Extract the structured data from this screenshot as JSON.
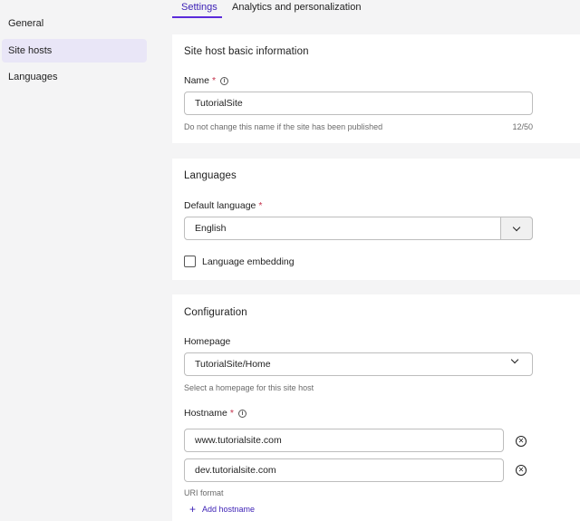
{
  "sidebar": {
    "items": [
      {
        "label": "General"
      },
      {
        "label": "Site hosts"
      },
      {
        "label": "Languages"
      }
    ]
  },
  "tabs": [
    {
      "label": "Settings"
    },
    {
      "label": "Analytics and personalization"
    }
  ],
  "basic_info": {
    "title": "Site host basic information",
    "name_label": "Name",
    "required_mark": "*",
    "name_value": "TutorialSite",
    "name_hint": "Do not change this name if the site has been published",
    "name_counter": "12/50"
  },
  "languages": {
    "title": "Languages",
    "default_label": "Default language",
    "required_mark": "*",
    "default_value": "English",
    "embedding_label": "Language embedding"
  },
  "configuration": {
    "title": "Configuration",
    "homepage_label": "Homepage",
    "homepage_value": "TutorialSite/Home",
    "homepage_hint": "Select a homepage for this site host",
    "hostname_label": "Hostname",
    "required_mark": "*",
    "hostnames": [
      {
        "value": "www.tutorialsite.com"
      },
      {
        "value": "dev.tutorialsite.com"
      }
    ],
    "uri_format": "URI format",
    "add_hostname": "Add hostname"
  },
  "colors": {
    "accent": "#5b2bdb",
    "required": "#c4314b",
    "active_nav_bg": "#e9e6f7"
  }
}
